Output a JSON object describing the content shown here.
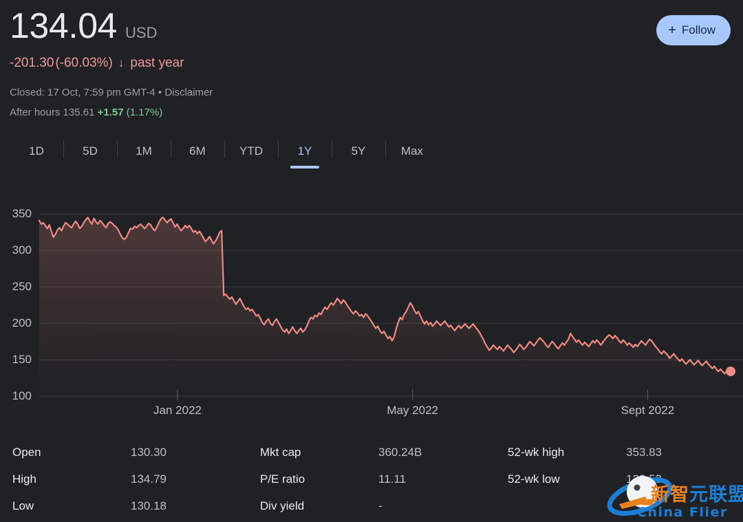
{
  "quote": {
    "price": "134.04",
    "currency": "USD",
    "change_abs": "-201.30",
    "change_pct": "(-60.03%)",
    "change_arrow": "↓",
    "change_period": "past year",
    "change_color": "#ef9a9a",
    "closed_text": "Closed: 17 Oct, 7:59 pm GMT-4 • ",
    "disclaimer_label": "Disclaimer",
    "after_hours_label": "After hours",
    "after_hours_price": "135.61",
    "after_hours_change": "+1.57",
    "after_hours_pct": "(1.17%)",
    "after_hours_color": "#81c995"
  },
  "follow": {
    "label": "Follow",
    "plus_icon": "+",
    "bg_color": "#a8c7fa"
  },
  "ranges": {
    "active": "1Y",
    "accent_color": "#a8c7fa",
    "tabs": [
      {
        "label": "1D"
      },
      {
        "label": "5D"
      },
      {
        "label": "1M"
      },
      {
        "label": "6M"
      },
      {
        "label": "YTD"
      },
      {
        "label": "1Y"
      },
      {
        "label": "5Y"
      },
      {
        "label": "Max"
      }
    ]
  },
  "chart_data": {
    "type": "line",
    "title": "",
    "xlabel": "",
    "ylabel": "",
    "line_color": "#f08a82",
    "fill_top_color": "rgba(240,138,130,0.22)",
    "fill_bottom_color": "rgba(240,138,130,0.0)",
    "grid": true,
    "legend": "none",
    "ylim": [
      100,
      362
    ],
    "yticks": [
      350,
      300,
      250,
      200,
      150,
      100
    ],
    "xticks": [
      "Jan 2022",
      "May 2022",
      "Sept 2022"
    ],
    "xtick_fractions": [
      0.2,
      0.54,
      0.88
    ],
    "last_point_marker": true,
    "last_value": 134.04,
    "values": [
      341,
      336,
      338,
      334,
      330,
      335,
      326,
      318,
      322,
      328,
      331,
      327,
      333,
      338,
      336,
      333,
      331,
      336,
      340,
      336,
      330,
      333,
      338,
      342,
      345,
      340,
      336,
      344,
      339,
      336,
      341,
      338,
      334,
      331,
      337,
      339,
      337,
      334,
      332,
      328,
      322,
      317,
      315,
      318,
      324,
      330,
      329,
      333,
      331,
      334,
      336,
      333,
      330,
      333,
      337,
      335,
      330,
      327,
      332,
      338,
      343,
      345,
      342,
      338,
      341,
      343,
      338,
      332,
      336,
      331,
      327,
      330,
      334,
      331,
      334,
      330,
      325,
      327,
      323,
      326,
      322,
      317,
      312,
      315,
      319,
      314,
      309,
      313,
      318,
      325,
      327,
      238,
      240,
      236,
      233,
      236,
      231,
      226,
      230,
      234,
      228,
      223,
      219,
      221,
      217,
      219,
      215,
      210,
      212,
      207,
      201,
      198,
      203,
      206,
      200,
      197,
      202,
      206,
      201,
      196,
      191,
      188,
      192,
      186,
      190,
      195,
      190,
      186,
      190,
      193,
      188,
      191,
      196,
      203,
      208,
      206,
      211,
      209,
      214,
      212,
      218,
      222,
      219,
      224,
      228,
      225,
      229,
      234,
      231,
      227,
      232,
      229,
      224,
      220,
      216,
      213,
      217,
      214,
      210,
      212,
      208,
      213,
      210,
      206,
      202,
      197,
      193,
      196,
      190,
      186,
      189,
      184,
      179,
      182,
      176,
      181,
      192,
      201,
      208,
      205,
      212,
      216,
      222,
      228,
      224,
      218,
      213,
      216,
      210,
      204,
      199,
      203,
      198,
      201,
      196,
      199,
      203,
      200,
      197,
      200,
      203,
      199,
      195,
      197,
      193,
      190,
      194,
      197,
      193,
      196,
      199,
      196,
      193,
      196,
      199,
      195,
      192,
      188,
      183,
      178,
      172,
      167,
      163,
      166,
      170,
      167,
      164,
      168,
      165,
      162,
      166,
      170,
      167,
      164,
      160,
      163,
      167,
      171,
      168,
      164,
      167,
      171,
      175,
      172,
      169,
      173,
      177,
      180,
      177,
      174,
      170,
      167,
      171,
      175,
      172,
      168,
      165,
      169,
      173,
      170,
      174,
      178,
      186,
      182,
      178,
      174,
      177,
      173,
      170,
      174,
      171,
      168,
      172,
      176,
      173,
      177,
      174,
      170,
      174,
      178,
      181,
      184,
      182,
      179,
      183,
      180,
      176,
      173,
      177,
      174,
      170,
      173,
      170,
      167,
      171,
      168,
      172,
      176,
      173,
      170,
      174,
      178,
      176,
      172,
      168,
      165,
      161,
      158,
      162,
      159,
      156,
      152,
      155,
      158,
      154,
      151,
      148,
      151,
      147,
      144,
      147,
      150,
      146,
      143,
      146,
      149,
      145,
      142,
      145,
      148,
      144,
      141,
      138,
      141,
      137,
      134,
      137,
      134,
      131,
      134,
      131,
      134
    ]
  },
  "stats": {
    "columns": [
      {
        "rows": [
          {
            "key": "Open",
            "value": "130.30"
          },
          {
            "key": "High",
            "value": "134.79"
          },
          {
            "key": "Low",
            "value": "130.18"
          }
        ]
      },
      {
        "rows": [
          {
            "key": "Mkt cap",
            "value": "360.24B"
          },
          {
            "key": "P/E ratio",
            "value": "11.11"
          },
          {
            "key": "Div yield",
            "value": "-"
          }
        ]
      },
      {
        "rows": [
          {
            "key": "52-wk high",
            "value": "353.83"
          },
          {
            "key": "52-wk low",
            "value": "122.53"
          },
          {
            "key": "",
            "value": ""
          }
        ]
      }
    ]
  },
  "watermark": {
    "brand_latin": "China Flier",
    "brand_cn_orange": "新智",
    "brand_cn_blue": "元联盟"
  }
}
